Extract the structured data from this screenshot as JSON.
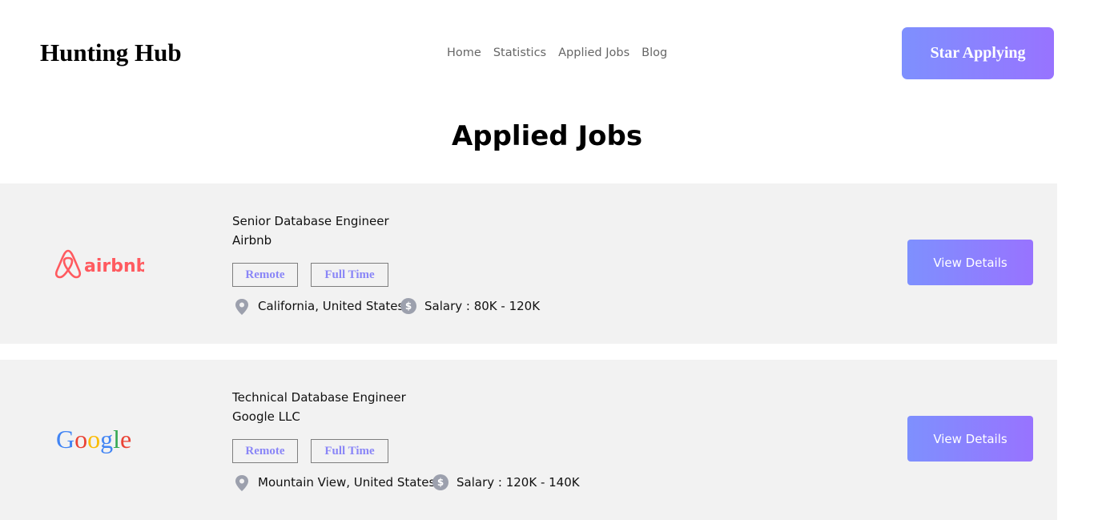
{
  "header": {
    "brand": "Hunting Hub",
    "nav": [
      "Home",
      "Statistics",
      "Applied Jobs",
      "Blog"
    ],
    "cta_label": "Star Applying"
  },
  "page_title": "Applied Jobs",
  "accent_colors": {
    "gradient_start": "#7e90fe",
    "gradient_end": "#9873ff",
    "tag_text": "#8a86f7",
    "card_bg": "#f2f2f2"
  },
  "jobs": [
    {
      "logo": "airbnb-logo",
      "logo_text": "airbnb",
      "title": "Senior Database Engineer",
      "company": "Airbnb",
      "tags": [
        "Remote",
        "Full Time"
      ],
      "location": "California, United States",
      "salary": "Salary : 80K - 120K",
      "action": "View Details"
    },
    {
      "logo": "google-logo",
      "logo_text": "Google",
      "title": "Technical Database Engineer",
      "company": "Google LLC",
      "tags": [
        "Remote",
        "Full Time"
      ],
      "location": "Mountain View, United States",
      "salary": "Salary : 120K - 140K",
      "action": "View Details"
    }
  ],
  "icons": {
    "location": "location-pin-icon",
    "salary": "dollar-circle-icon",
    "salary_glyph": "$"
  }
}
